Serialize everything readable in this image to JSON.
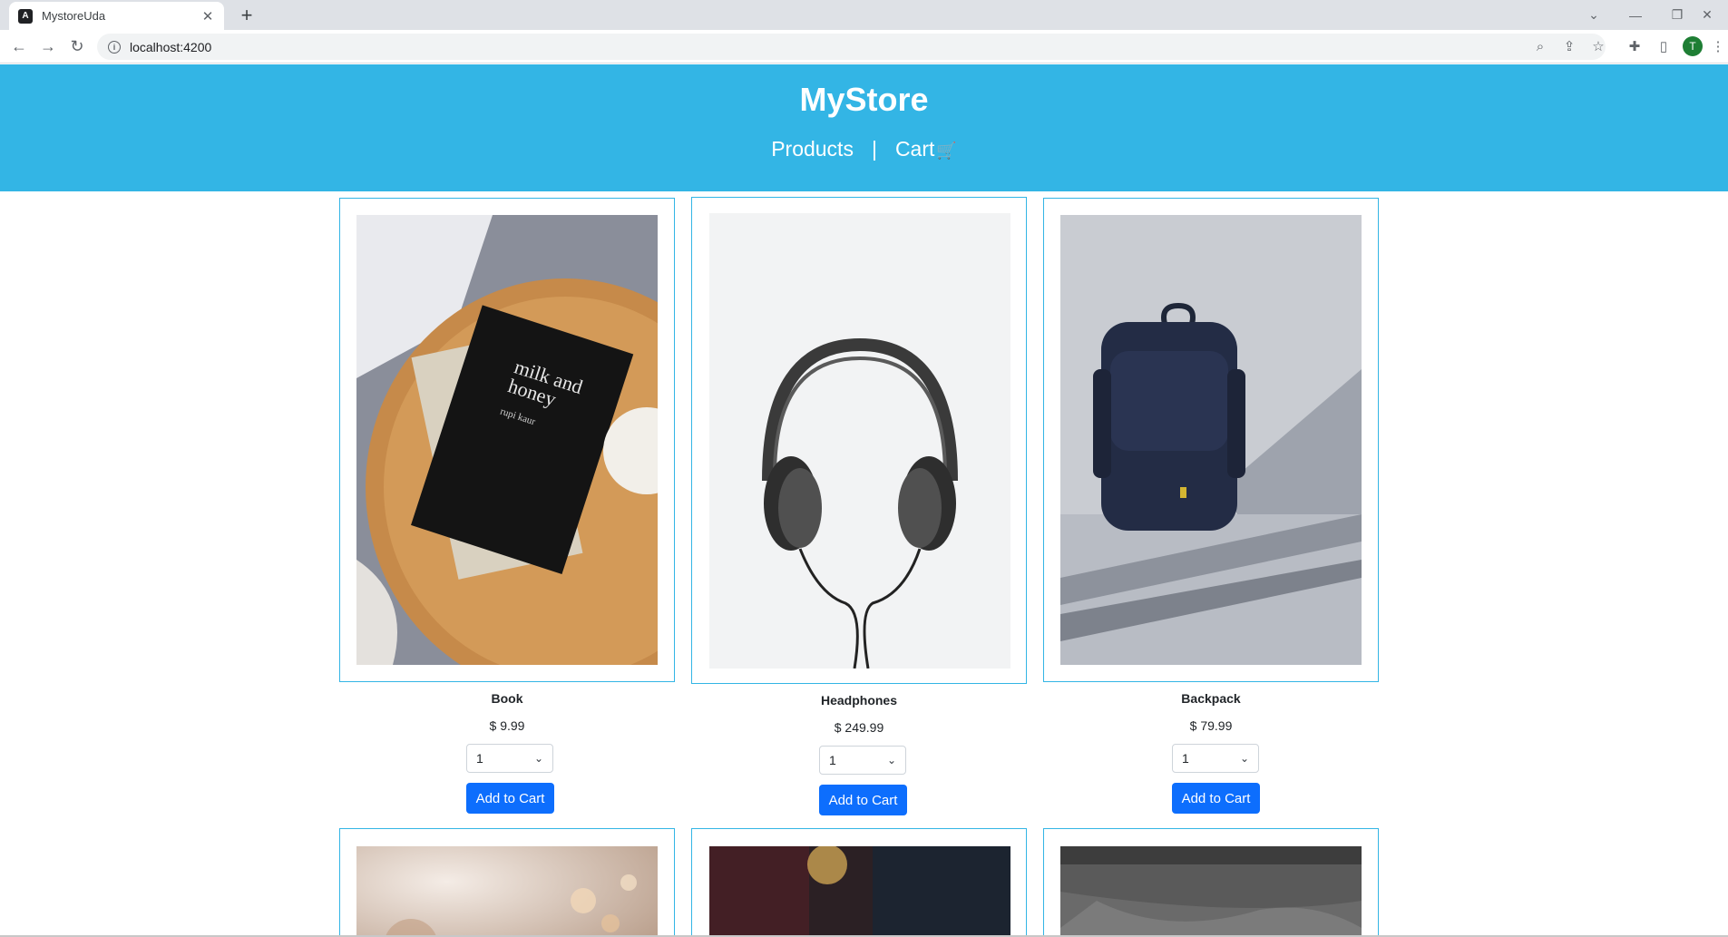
{
  "browser": {
    "tab_title": "MystoreUda",
    "favicon_letter": "A",
    "url": "localhost:4200",
    "avatar_letter": "T"
  },
  "header": {
    "brand": "MyStore",
    "nav": {
      "products": "Products",
      "separator": "|",
      "cart": "Cart"
    }
  },
  "products": [
    {
      "name": "Book",
      "price": "$ 9.99",
      "qty": "1",
      "button": "Add to Cart"
    },
    {
      "name": "Headphones",
      "price": "$ 249.99",
      "qty": "1",
      "button": "Add to Cart"
    },
    {
      "name": "Backpack",
      "price": "$ 79.99",
      "qty": "1",
      "button": "Add to Cart"
    }
  ],
  "colors": {
    "header_bg": "#33b5e5",
    "button_bg": "#0d6efd",
    "card_border": "#33b5e5"
  }
}
